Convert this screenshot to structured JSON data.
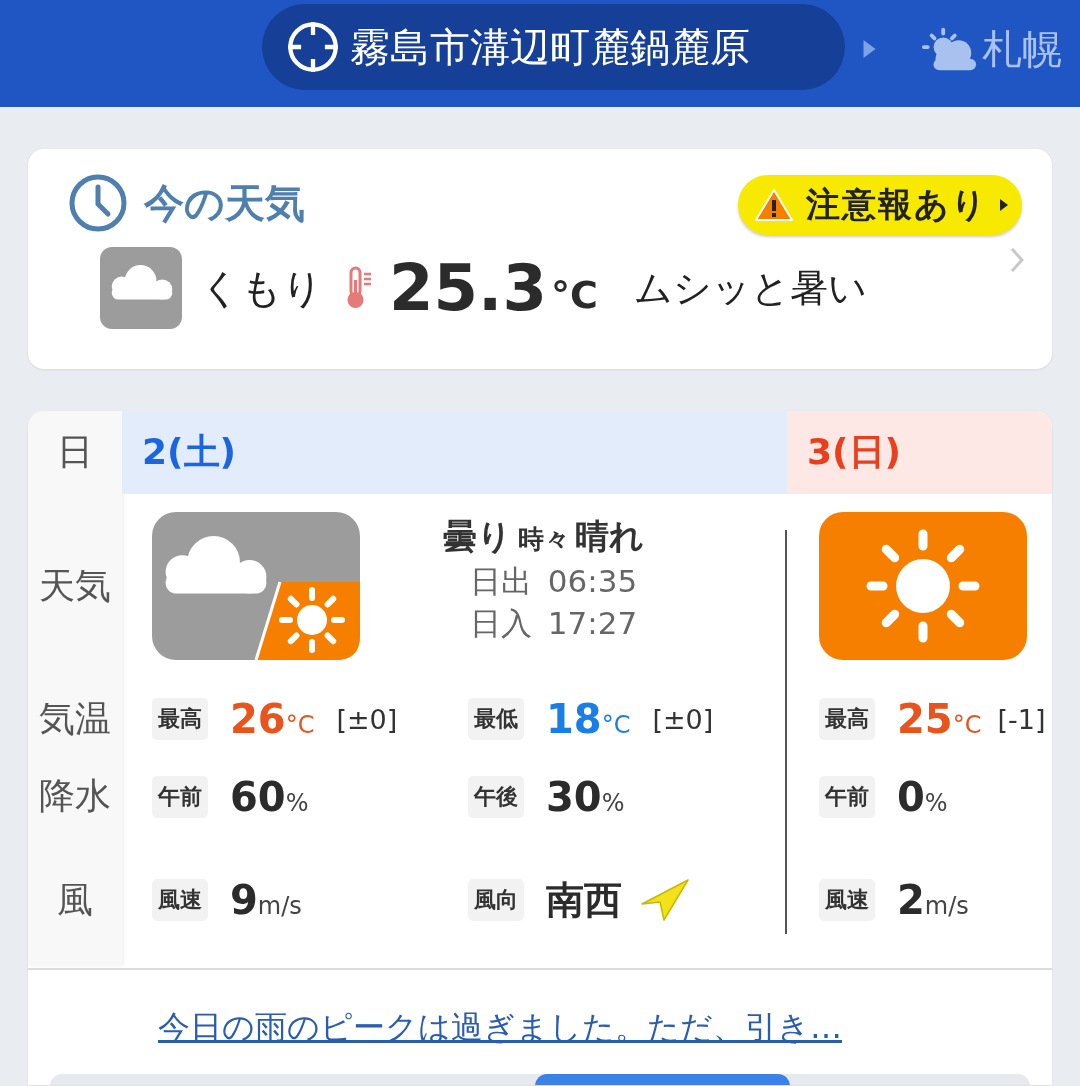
{
  "header": {
    "location": "霧島市溝辺町麓鍋麓原",
    "next_location": "札幌"
  },
  "current": {
    "title": "今の天気",
    "alert": "注意報あり",
    "icon": {
      "kind": "cloudy"
    },
    "weather": "くもり",
    "temperature": "25.3",
    "unit": "°C",
    "feeling": "ムシッと暑い"
  },
  "forecast": {
    "row_labels": [
      "日",
      "天気",
      "気温",
      "降水",
      "風"
    ],
    "days": [
      {
        "date": "2(土)",
        "kind": "saturday",
        "icon": {
          "kind": "cloudy_sun"
        },
        "weather_text": [
          "曇り",
          "時々",
          "晴れ"
        ],
        "sun": [
          {
            "label": "日出",
            "time": "06:35"
          },
          {
            "label": "日入",
            "time": "17:27"
          }
        ],
        "temps": [
          {
            "kind": "high",
            "label": "最高",
            "value": "26",
            "unit": "°C",
            "diff": "[±0]"
          },
          {
            "kind": "low",
            "label": "最低",
            "value": "18",
            "unit": "°C",
            "diff": "[±0]"
          }
        ],
        "precip": [
          {
            "label": "午前",
            "value": "60",
            "unit": "%"
          },
          {
            "label": "午後",
            "value": "30",
            "unit": "%"
          }
        ],
        "wind": [
          {
            "kind": "speed",
            "label": "風速",
            "value": "9",
            "unit": "m/s"
          },
          {
            "kind": "direction",
            "label": "風向",
            "value": "南西"
          }
        ]
      },
      {
        "date": "3(日)",
        "kind": "sunday",
        "icon": {
          "kind": "sunny"
        },
        "temps": [
          {
            "kind": "high",
            "label": "最高",
            "value": "25",
            "unit": "°C",
            "diff": "[-1]"
          }
        ],
        "precip": [
          {
            "label": "午前",
            "value": "0",
            "unit": "%"
          }
        ],
        "wind": [
          {
            "kind": "speed",
            "label": "風速",
            "value": "2",
            "unit": "m/s"
          }
        ]
      }
    ]
  },
  "comment": "今日の雨のピークは過ぎました。ただ、引き…"
}
